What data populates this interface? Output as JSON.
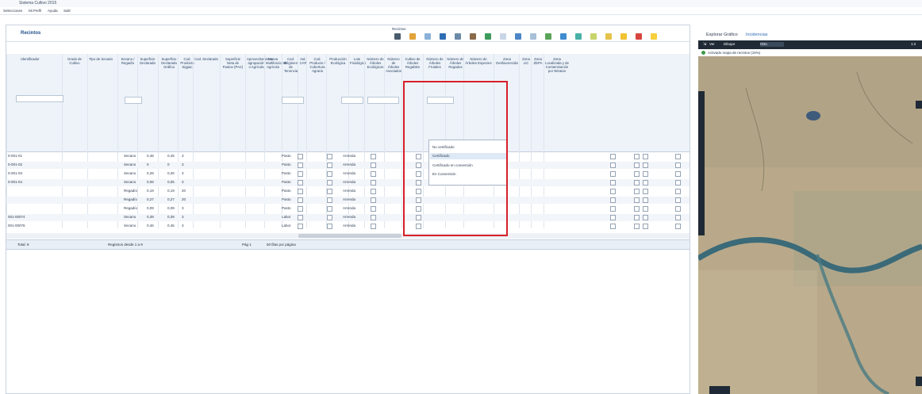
{
  "window": {
    "title": "Sistema Cultivo 2015"
  },
  "menu": [
    "Selecciones",
    "Mi Perfil",
    "Ayuda",
    "Salir"
  ],
  "panel": {
    "title": "Recintos",
    "toolbar_label": "Recintos"
  },
  "toolbar_colors": [
    "#4a5b6e",
    "#e2a33a",
    "#8bb1d8",
    "#2f6db5",
    "#6b8aa8",
    "#8a6a4a",
    "#3d9a5a",
    "#c8d6e6",
    "#4c86c6",
    "#a8bfd8",
    "#5aa35a",
    "#3f8cd1",
    "#48b0a8",
    "#c9d46a",
    "#e6c24a",
    "#f1c232",
    "#d7453f",
    "#f6cf3a"
  ],
  "columns": [
    {
      "label": "Identificador"
    },
    {
      "label": "Grado de Cultivo"
    },
    {
      "label": "Tipo de Secado"
    },
    {
      "label": "Secano / Regadío"
    },
    {
      "label": "Superficie Declarada"
    },
    {
      "label": "Superficie Declarada Gráfica"
    },
    {
      "label": "Cod. Producto Sigpac"
    },
    {
      "label": "Cod. Declarado"
    },
    {
      "label": "Superficie Neta de Pastos (PAC)"
    },
    {
      "label": "Aprovechamiento agrupación o Agrícola"
    },
    {
      "label": "Nueva Multifuncional Agrícola"
    },
    {
      "label": "Cod. Régimen de Tenencia"
    },
    {
      "label": "Ind. CAP"
    },
    {
      "label": "Cod. Producto / Cobertura Agraria"
    },
    {
      "label": "Producción Ecológica"
    },
    {
      "label": "Lote Fisiológico"
    },
    {
      "label": "Número de Árboles Ecológicos"
    },
    {
      "label": "Número de Árboles Asociados"
    },
    {
      "label": "Cultivo de Árboles Regables"
    },
    {
      "label": "Número de Árboles Frutales"
    },
    {
      "label": "Número de Árboles Regados"
    },
    {
      "label": "Número de Árboles Especies"
    },
    {
      "label": "Zona Desfavorecida"
    },
    {
      "label": "Zona LIC"
    },
    {
      "label": "Zona ZEPA"
    },
    {
      "label": "Zona Localizada y de Contaminación por Nitratos"
    }
  ],
  "rows": [
    {
      "id": "0-001-01",
      "sec": "Secano",
      "sup": "0,48",
      "sgr": "0,45",
      "cod": "3",
      "aprov": "Pasto",
      "reg": "Arrenda",
      "eco": true
    },
    {
      "id": "0-001-02",
      "sec": "Secano",
      "sup": "0",
      "sgr": "0",
      "cod": "3",
      "aprov": "Pasto",
      "reg": "Arrenda",
      "eco": true
    },
    {
      "id": "0-001-03",
      "sec": "Secano",
      "sup": "0,28",
      "sgr": "0,26",
      "cod": "3",
      "aprov": "Pasto",
      "reg": "Arrenda",
      "eco": true
    },
    {
      "id": "0-001-04",
      "sec": "Secano",
      "sup": "0,06",
      "sgr": "0,05",
      "cod": "3",
      "aprov": "Pasto",
      "reg": "Arrenda",
      "eco": true
    },
    {
      "id": "",
      "sec": "Regadío",
      "sup": "0,19",
      "sgr": "0,19",
      "cod": "20",
      "aprov": "Pasto",
      "reg": "Arrenda",
      "eco": false
    },
    {
      "id": "",
      "sec": "Regadío",
      "sup": "0,27",
      "sgr": "0,27",
      "cod": "20",
      "aprov": "Pasto",
      "reg": "Arrenda",
      "eco": false
    },
    {
      "id": "",
      "sec": "Regadío",
      "sup": "0,09",
      "sgr": "0,09",
      "cod": "3",
      "aprov": "Pasto",
      "reg": "Arrenda",
      "eco": false
    },
    {
      "id": "001-00074",
      "sec": "Secano",
      "sup": "0,39",
      "sgr": "0,39",
      "cod": "3",
      "aprov": "Labor",
      "reg": "Arrenda",
      "eco": false
    },
    {
      "id": "001-00076",
      "sec": "Secano",
      "sup": "0,46",
      "sgr": "0,45",
      "cod": "3",
      "aprov": "Labor",
      "reg": "Arrenda",
      "eco": false
    }
  ],
  "dropdown": {
    "options": [
      "No certificado",
      "Certificado",
      "Certificado en conversión",
      "En Conversión"
    ],
    "selected": "Certificado"
  },
  "footer": {
    "total": "Total: 9",
    "showing": "Registros desde 1 a 9",
    "page": "Pág 1",
    "per_page": "50 filas por página"
  },
  "map_panel": {
    "title": "Explorar Gráfico",
    "link": "Incidencias",
    "tools": [
      "Ver",
      "Dibujar"
    ],
    "layer": "Orto",
    "status": "Activado mapa de recintos (15%)",
    "scale_label": "1:2"
  }
}
